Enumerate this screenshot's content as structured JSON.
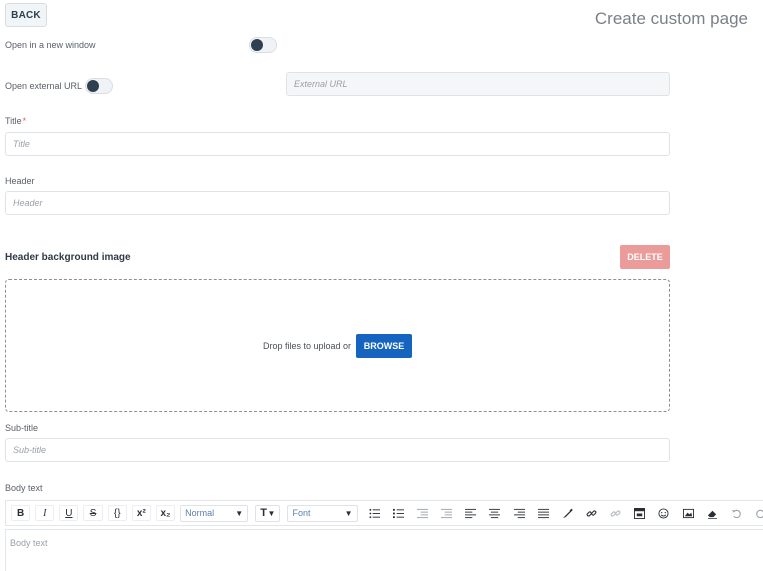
{
  "header": {
    "back_label": "BACK",
    "title": "Create custom page"
  },
  "form": {
    "open_new_window": {
      "label": "Open in a new window",
      "enabled": false
    },
    "open_external_url": {
      "label": "Open external URL",
      "enabled": false,
      "input_placeholder": "External URL"
    },
    "title": {
      "label": "Title",
      "required_mark": "*",
      "placeholder": "Title"
    },
    "header": {
      "label": "Header",
      "placeholder": "Header"
    },
    "header_background": {
      "section_title": "Header background image",
      "delete_label": "DELETE",
      "drop_text": "Drop files to upload or",
      "browse_label": "BROWSE"
    },
    "subtitle": {
      "label": "Sub-title",
      "placeholder": "Sub-title"
    },
    "body_text": {
      "label": "Body text",
      "placeholder": "Body text",
      "toolbar": {
        "bold": "B",
        "italic": "I",
        "underline": "U",
        "strike": "S",
        "code": "{}",
        "superscript": "x²",
        "subscript": "x₂",
        "block_type": "Normal",
        "text_size": "T",
        "font": "Font"
      }
    }
  },
  "colors": {
    "accent": "#1565c0",
    "delete": "#ec9b9b",
    "toggle_knob": "#2e3f50"
  }
}
